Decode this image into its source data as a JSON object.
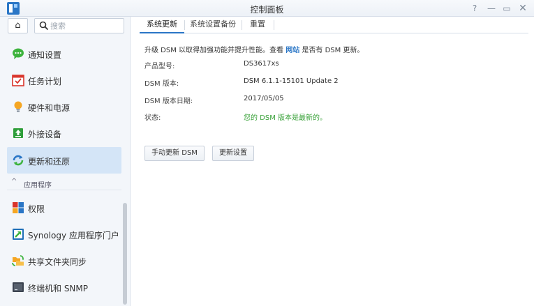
{
  "window": {
    "title": "控制面板",
    "help_glyph": "?",
    "minimize_glyph": "—",
    "maximize_glyph": "▭",
    "close_glyph": "✕"
  },
  "sidebar": {
    "home_glyph": "⌂",
    "search": {
      "placeholder": "搜索"
    },
    "items": [
      {
        "label": "通知设置",
        "icon": "chat-bubble-icon",
        "color": "#3db33d"
      },
      {
        "label": "任务计划",
        "icon": "calendar-check-icon",
        "color": "#d9342b"
      },
      {
        "label": "硬件和电源",
        "icon": "light-bulb-icon",
        "color": "#f5a623"
      },
      {
        "label": "外接设备",
        "icon": "external-device-icon",
        "color": "#2e9e3a"
      },
      {
        "label": "更新和还原",
        "icon": "refresh-icon",
        "color": "#2a76c6",
        "active": true
      }
    ],
    "section": {
      "label": "应用程序",
      "chevron": "^"
    },
    "app_items": [
      {
        "label": "权限",
        "icon": "permission-grid-icon"
      },
      {
        "label": "Synology 应用程序门户",
        "icon": "app-portal-icon"
      },
      {
        "label": "共享文件夹同步",
        "icon": "folder-sync-icon"
      },
      {
        "label": "终端机和 SNMP",
        "icon": "terminal-icon"
      }
    ]
  },
  "main": {
    "tabs": [
      {
        "label": "系统更新",
        "active": true
      },
      {
        "label": "系统设置备份"
      },
      {
        "label": "重置"
      }
    ],
    "info": {
      "prefix": "升级 DSM 以取得加强功能并提升性能。查看 ",
      "link": "网站",
      "suffix": " 是否有 DSM 更新。"
    },
    "rows": [
      {
        "label": "产品型号:",
        "value": "DS3617xs"
      },
      {
        "label": "DSM 版本:",
        "value": "DSM 6.1.1-15101 Update 2"
      },
      {
        "label": "DSM 版本日期:",
        "value": "2017/05/05"
      },
      {
        "label": "状态:",
        "value": "您的 DSM 版本是最新的。"
      }
    ],
    "buttons": {
      "manual_update": "手动更新 DSM",
      "update_settings": "更新设置"
    }
  },
  "colors": {
    "accent": "#2a76c6",
    "status_ok": "#3aa23a",
    "active_bg": "#d4e5f7"
  }
}
